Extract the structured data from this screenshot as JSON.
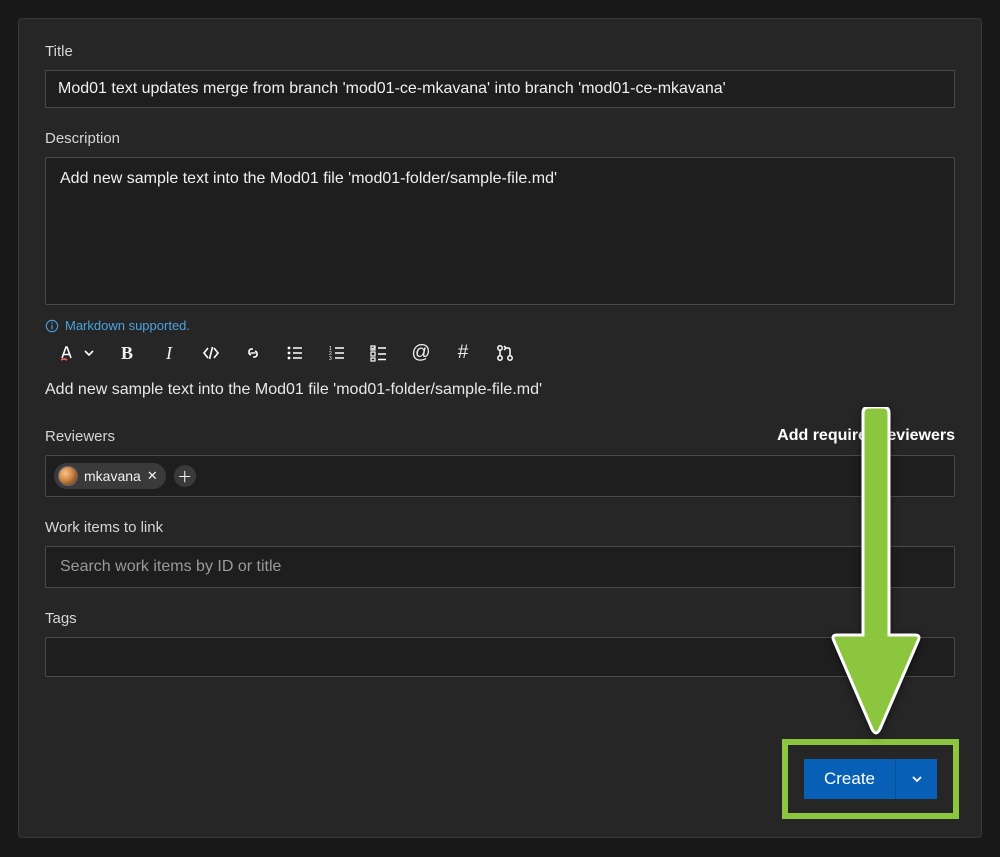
{
  "title": {
    "label": "Title",
    "value": "Mod01 text updates merge from branch 'mod01-ce-mkavana' into branch 'mod01-ce-mkavana'"
  },
  "description": {
    "label": "Description",
    "value": "Add new sample text into the Mod01 file 'mod01-folder/sample-file.md'"
  },
  "markdown_hint": "Markdown supported.",
  "preview_text": "Add new sample text into the Mod01 file 'mod01-folder/sample-file.md'",
  "reviewers": {
    "label": "Reviewers",
    "add_required_label": "Add required reviewers",
    "chips": [
      {
        "name": "mkavana"
      }
    ]
  },
  "work_items": {
    "label": "Work items to link",
    "placeholder": "Search work items by ID or title"
  },
  "tags": {
    "label": "Tags"
  },
  "actions": {
    "create_label": "Create"
  },
  "colors": {
    "accent": "#0860b6",
    "annotation": "#8cc63f",
    "link": "#4aa3df"
  }
}
